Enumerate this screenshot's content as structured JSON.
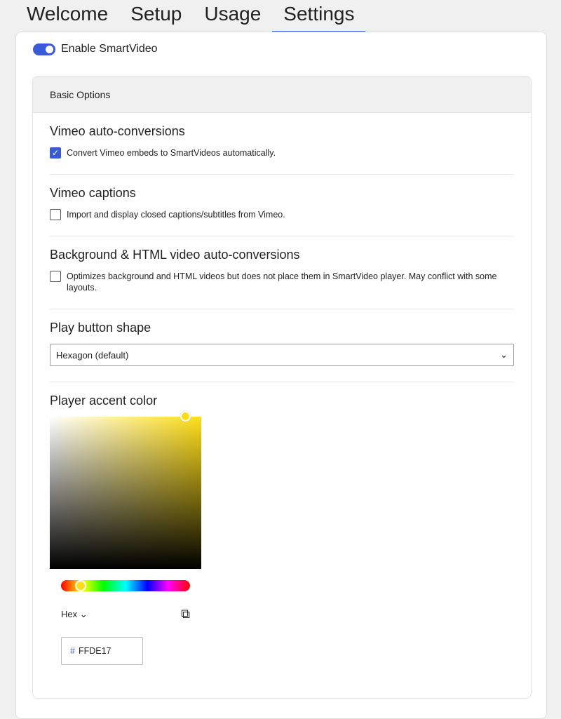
{
  "tabs": [
    {
      "label": "Welcome"
    },
    {
      "label": "Setup"
    },
    {
      "label": "Usage"
    },
    {
      "label": "Settings",
      "active": true
    }
  ],
  "enable_toggle": {
    "label": "Enable SmartVideo",
    "on": true
  },
  "panel": {
    "title": "Basic Options",
    "sections": [
      {
        "title": "Vimeo auto-conversions",
        "checkbox_label": "Convert Vimeo embeds to SmartVideos automatically.",
        "checked": true
      },
      {
        "title": "Vimeo captions",
        "checkbox_label": "Import and display closed captions/subtitles from Vimeo.",
        "checked": false
      },
      {
        "title": "Background & HTML video auto-conversions",
        "checkbox_label": "Optimizes background and HTML videos but does not place them in SmartVideo player. May conflict with some layouts.",
        "checked": false
      }
    ],
    "play_button": {
      "title": "Play button shape",
      "value": "Hexagon (default)"
    },
    "accent": {
      "title": "Player accent color",
      "format": "Hex",
      "hash": "#",
      "value": "FFDE17",
      "color": "#ffde17"
    }
  }
}
